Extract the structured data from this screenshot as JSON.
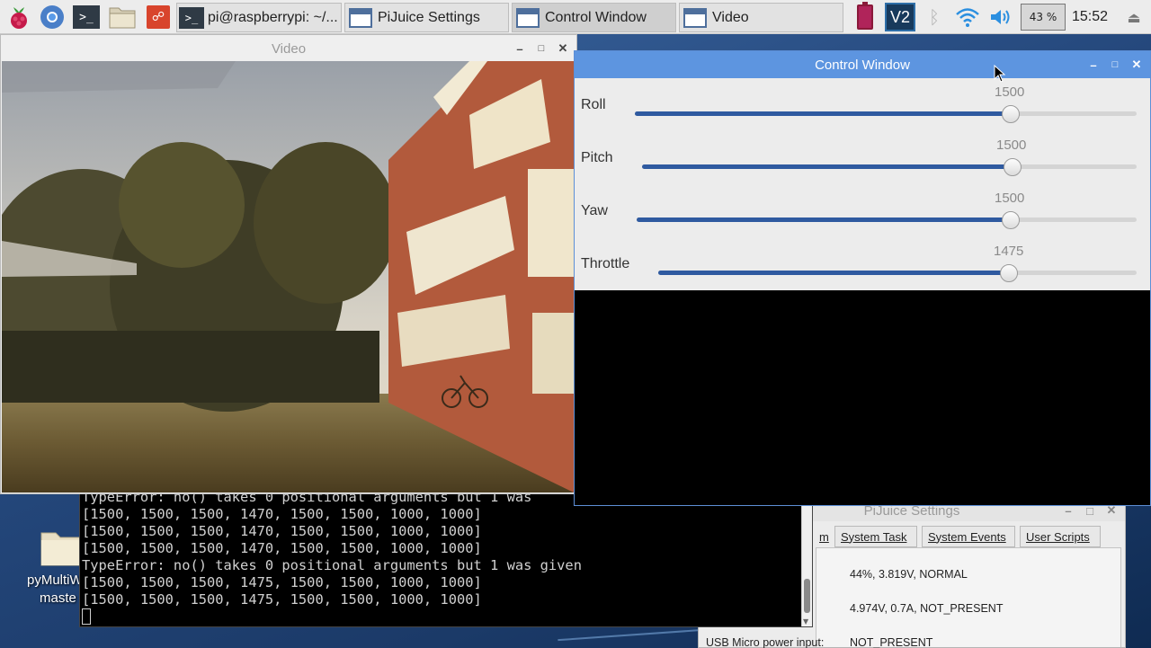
{
  "taskbar": {
    "launchers": [
      "raspberry-menu",
      "chromium-browser",
      "terminal",
      "file-manager",
      "mathematica"
    ],
    "tasks": [
      {
        "label": "pi@raspberrypi: ~/..."
      },
      {
        "label": "PiJuice Settings"
      },
      {
        "label": "Control Window"
      },
      {
        "label": "Video"
      }
    ],
    "vnc_label": "V2",
    "cpu_usage": "43 %",
    "time": "15:52"
  },
  "video_window": {
    "title": "Video"
  },
  "control_window": {
    "title": "Control Window",
    "sliders": [
      {
        "label": "Roll",
        "value": "1500",
        "position": 0.75
      },
      {
        "label": "Pitch",
        "value": "1500",
        "position": 0.75
      },
      {
        "label": "Yaw",
        "value": "1500",
        "position": 0.75
      },
      {
        "label": "Throttle",
        "value": "1475",
        "position": 0.73
      }
    ]
  },
  "terminal": {
    "lines": [
      "TypeError: no() takes 0 positional arguments but 1 was",
      "[1500, 1500, 1500, 1470, 1500, 1500, 1000, 1000]",
      "[1500, 1500, 1500, 1470, 1500, 1500, 1000, 1000]",
      "[1500, 1500, 1500, 1470, 1500, 1500, 1000, 1000]",
      "TypeError: no() takes 0 positional arguments but 1 was given",
      "[1500, 1500, 1500, 1475, 1500, 1500, 1000, 1000]",
      "[1500, 1500, 1500, 1475, 1500, 1500, 1000, 1000]"
    ]
  },
  "desktop": {
    "folder_label_line1": "pyMultiW",
    "folder_label_line2": "maste"
  },
  "pijuice_window": {
    "title": "PiJuice Settings",
    "tabs": [
      "m",
      "System Task",
      "System Events",
      "User Scripts"
    ],
    "battery_status": "44%, 3.819V, NORMAL",
    "gpio_power_status": "4.974V, 0.7A, NOT_PRESENT",
    "usb_label": "USB Micro power input:",
    "usb_value": "NOT_PRESENT"
  }
}
